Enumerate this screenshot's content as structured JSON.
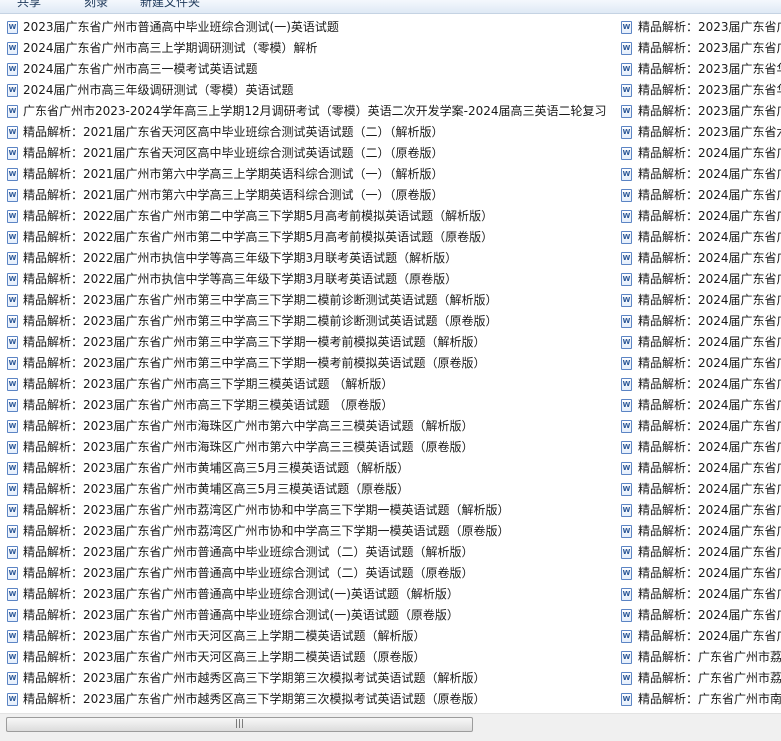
{
  "toolbar": {
    "items": [
      "共享",
      "刻录",
      "新建文件夹"
    ]
  },
  "files": {
    "column1": [
      "2023届广东省广州市普通高中毕业班综合测试(一)英语试题",
      "2024届广东省广州市高三上学期调研测试（零模）解析",
      "2024届广东省广州市高三一模考试英语试题",
      "2024届广州市高三年级调研测试（零模）英语试题",
      "广东省广州市2023-2024学年高三上学期12月调研考试（零模）英语二次开发学案-2024届高三英语二轮复习",
      "精品解析：2021届广东省天河区高中毕业班综合测试英语试题（二）（解析版）",
      "精品解析：2021届广东省天河区高中毕业班综合测试英语试题（二）（原卷版）",
      "精品解析：2021届广州市第六中学高三上学期英语科综合测试（一）（解析版）",
      "精品解析：2021届广州市第六中学高三上学期英语科综合测试（一）（原卷版）",
      "精品解析：2022届广东省广州市第二中学高三下学期5月高考前模拟英语试题（解析版）",
      "精品解析：2022届广东省广州市第二中学高三下学期5月高考前模拟英语试题（原卷版）",
      "精品解析：2022届广州市执信中学等高三年级下学期3月联考英语试题（解析版）",
      "精品解析：2022届广州市执信中学等高三年级下学期3月联考英语试题（原卷版）",
      "精品解析：2023届广东省广州市第三中学高三下学期二模前诊断测试英语试题（解析版）",
      "精品解析：2023届广东省广州市第三中学高三下学期二模前诊断测试英语试题（原卷版）",
      "精品解析：2023届广东省广州市第三中学高三下学期一模考前模拟英语试题（解析版）",
      "精品解析：2023届广东省广州市第三中学高三下学期一模考前模拟英语试题（原卷版）",
      "精品解析：2023届广东省广州市高三下学期三模英语试题 （解析版）",
      "精品解析：2023届广东省广州市高三下学期三模英语试题 （原卷版）",
      "精品解析：2023届广东省广州市海珠区广州市第六中学高三三模英语试题（解析版）",
      "精品解析：2023届广东省广州市海珠区广州市第六中学高三三模英语试题（原卷版）",
      "精品解析：2023届广东省广州市黄埔区高三5月三模英语试题（解析版）",
      "精品解析：2023届广东省广州市黄埔区高三5月三模英语试题（原卷版）",
      "精品解析：2023届广东省广州市荔湾区广州市协和中学高三下学期一模英语试题（解析版）",
      "精品解析：2023届广东省广州市荔湾区广州市协和中学高三下学期一模英语试题（原卷版）",
      "精品解析：2023届广东省广州市普通高中毕业班综合测试（二）英语试题（解析版）",
      "精品解析：2023届广东省广州市普通高中毕业班综合测试（二）英语试题（原卷版）",
      "精品解析：2023届广东省广州市普通高中毕业班综合测试(一)英语试题（解析版）",
      "精品解析：2023届广东省广州市普通高中毕业班综合测试(一)英语试题（原卷版）",
      "精品解析：2023届广东省广州市天河区高三上学期二模英语试题（解析版）",
      "精品解析：2023届广东省广州市天河区高三上学期二模英语试题（原卷版）",
      "精品解析：2023届广东省广州市越秀区高三下学期第三次模拟考试英语试题（解析版）",
      "精品解析：2023届广东省广州市越秀区高三下学期第三次模拟考试英语试题（原卷版）"
    ],
    "column2": [
      "精品解析：2023届广东省广",
      "精品解析：2023届广东省广",
      "精品解析：2023届广东省华",
      "精品解析：2023届广东省华",
      "精品解析：2023届广东省广",
      "精品解析：2023届广东省六",
      "精品解析：2024届广东省广",
      "精品解析：2024届广东省广",
      "精品解析：2024届广东省广",
      "精品解析：2024届广东省广",
      "精品解析：2024届广东省广",
      "精品解析：2024届广东省广",
      "精品解析：2024届广东省广",
      "精品解析：2024届广东省广",
      "精品解析：2024届广东省广",
      "精品解析：2024届广东省广",
      "精品解析：2024届广东省广",
      "精品解析：2024届广东省广",
      "精品解析：2024届广东省广",
      "精品解析：2024届广东省广",
      "精品解析：2024届广东省广",
      "精品解析：2024届广东省广",
      "精品解析：2024届广东省广",
      "精品解析：2024届广东省广",
      "精品解析：2024届广东省广",
      "精品解析：2024届广东省广",
      "精品解析：2024届广东省广",
      "精品解析：2024届广东省广",
      "精品解析：2024届广东省广",
      "精品解析：2024届广东省广",
      "精品解析：广东省广州市荔",
      "精品解析：广东省广州市荔",
      "精品解析：广东省广州市南"
    ]
  },
  "scrollbar": {
    "grip": "|||"
  },
  "colors": {
    "accent": "#2b5797",
    "toolbar_bg": "#dfe9f5",
    "text": "#1a1a1a"
  },
  "icons": {
    "file": "word-document-icon"
  }
}
